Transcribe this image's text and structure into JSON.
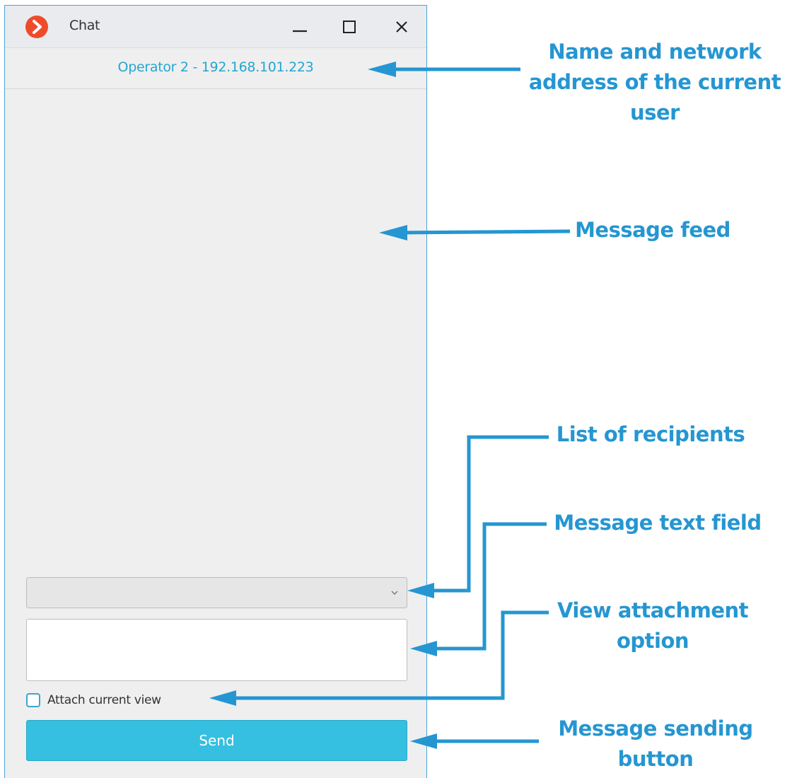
{
  "window": {
    "title": "Chat",
    "current_user": "Operator 2 - 192.168.101.223"
  },
  "titlebar_icons": {
    "logo": "app-logo-icon",
    "minimize": "minimize-icon",
    "maximize": "maximize-icon",
    "close": "close-icon"
  },
  "composer": {
    "recipients_value": "",
    "message_value": "",
    "attach_label": "Attach current view",
    "attach_checked": false,
    "send_label": "Send"
  },
  "annotations": {
    "user": [
      "Name and network",
      "address of the current",
      "user"
    ],
    "feed": "Message feed",
    "recipients": "List of recipients",
    "text_field": "Message text field",
    "attachment": [
      "View attachment",
      "option"
    ],
    "send": [
      "Message sending",
      "button"
    ]
  },
  "colors": {
    "accent": "#35bfe0",
    "header_text": "#22a7d0",
    "annotation": "#2596d1",
    "window_border": "#4aa3d6",
    "logo": "#ee4b2b"
  }
}
